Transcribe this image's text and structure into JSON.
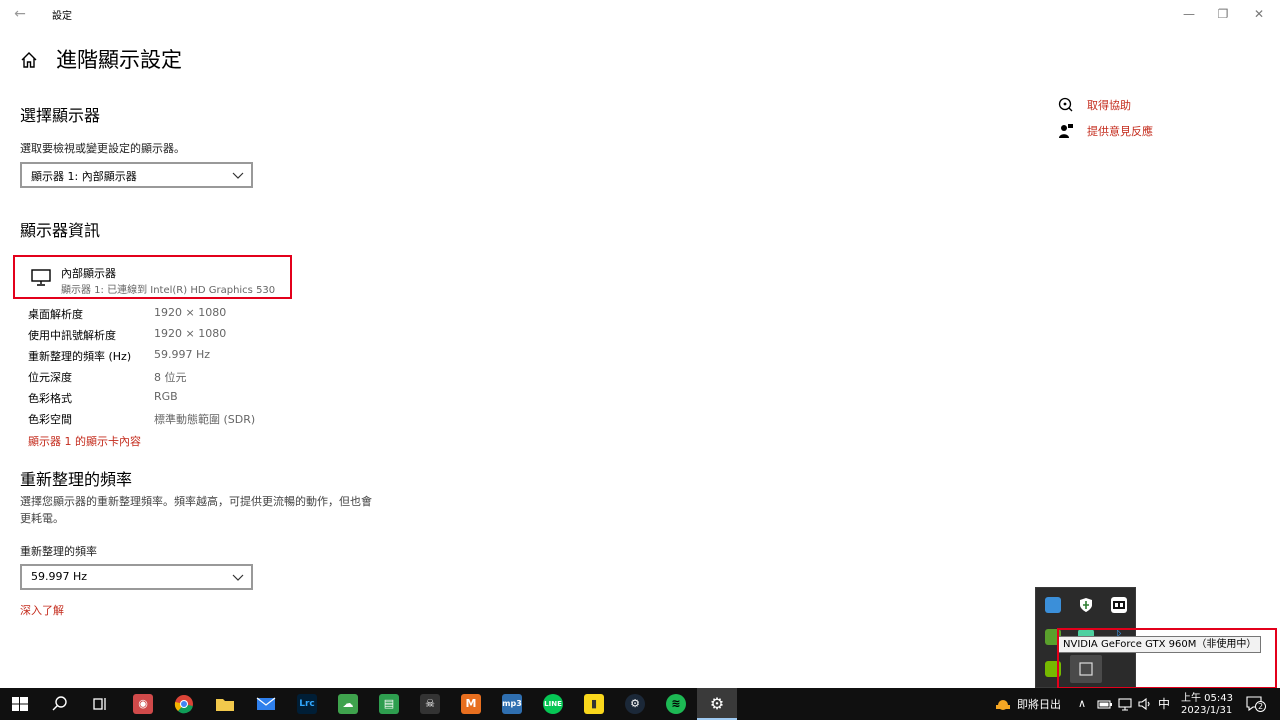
{
  "window": {
    "title": "設定",
    "back_glyph": "←",
    "minimize_glyph": "—",
    "maximize_glyph": "❐",
    "close_glyph": "✕"
  },
  "page": {
    "title": "進階顯示設定"
  },
  "select_display": {
    "heading": "選擇顯示器",
    "description": "選取要檢視或變更設定的顯示器。",
    "dropdown_value": "顯示器 1: 內部顯示器"
  },
  "display_info": {
    "heading": "顯示器資訊",
    "monitor_name": "內部顯示器",
    "monitor_sub": "顯示器 1: 已連線到 Intel(R) HD Graphics 530",
    "rows": [
      {
        "label": "桌面解析度",
        "value": "1920 × 1080"
      },
      {
        "label": "使用中訊號解析度",
        "value": "1920 × 1080"
      },
      {
        "label": "重新整理的頻率 (Hz)",
        "value": "59.997 Hz"
      },
      {
        "label": "位元深度",
        "value": "8 位元"
      },
      {
        "label": "色彩格式",
        "value": "RGB"
      },
      {
        "label": "色彩空間",
        "value": "標準動態範圍 (SDR)"
      }
    ],
    "adapter_link": "顯示器 1 的顯示卡內容"
  },
  "refresh_rate": {
    "heading": "重新整理的頻率",
    "description_line1": "選擇您顯示器的重新整理頻率。頻率越高，可提供更流暢的動作，但也會",
    "description_line2": "更耗電。",
    "field_label": "重新整理的頻率",
    "dropdown_value": "59.997 Hz",
    "learn_more": "深入了解"
  },
  "help": {
    "get_help": "取得協助",
    "feedback": "提供意見反應"
  },
  "tray_flyout": {
    "tooltip": "NVIDIA GeForce GTX 960M（非使用中）",
    "icons": [
      "network-app-icon",
      "defender-shield-icon",
      "media-app-icon",
      "game-app-icon",
      "green-app-icon",
      "bluetooth-icon",
      "nvidia-icon",
      "gpu-activity-icon"
    ]
  },
  "taskbar": {
    "apps": [
      {
        "name": "start",
        "glyph": "⊞",
        "color": "#ffffff"
      },
      {
        "name": "search",
        "glyph": "⚲",
        "color": "#ffffff"
      },
      {
        "name": "task-view",
        "glyph": "⧉",
        "color": "#ffffff"
      },
      {
        "name": "game",
        "glyph": "◉",
        "color": "#d04a4a"
      },
      {
        "name": "chrome",
        "glyph": "●",
        "color": "#4caf50"
      },
      {
        "name": "file-explorer",
        "glyph": "▬",
        "color": "#f2c94c"
      },
      {
        "name": "mail",
        "glyph": "✉",
        "color": "#2f80ed"
      },
      {
        "name": "lightroom",
        "glyph": "Lrc",
        "color": "#001e36"
      },
      {
        "name": "cloud-app",
        "glyph": "☁",
        "color": "#3fa34d"
      },
      {
        "name": "notes",
        "glyph": "▤",
        "color": "#2e9e4f"
      },
      {
        "name": "pirate-game",
        "glyph": "☠",
        "color": "#333333"
      },
      {
        "name": "mega",
        "glyph": "M",
        "color": "#e86f1f"
      },
      {
        "name": "mp3",
        "glyph": "mp3",
        "color": "#2f6fb0"
      },
      {
        "name": "line",
        "glyph": "LINE",
        "color": "#06c755"
      },
      {
        "name": "sticky-notes",
        "glyph": "▮",
        "color": "#f9d71c"
      },
      {
        "name": "steam",
        "glyph": "⚙",
        "color": "#1b2838"
      },
      {
        "name": "spotify",
        "glyph": "≋",
        "color": "#1db954"
      },
      {
        "name": "settings",
        "glyph": "⚙",
        "color": "#3a3a3a"
      }
    ],
    "weather_label": "即將日出",
    "ime": "中",
    "time": "上午 05:43",
    "date": "2023/1/31",
    "notification_count": "2",
    "chevron_glyph": "∧"
  }
}
